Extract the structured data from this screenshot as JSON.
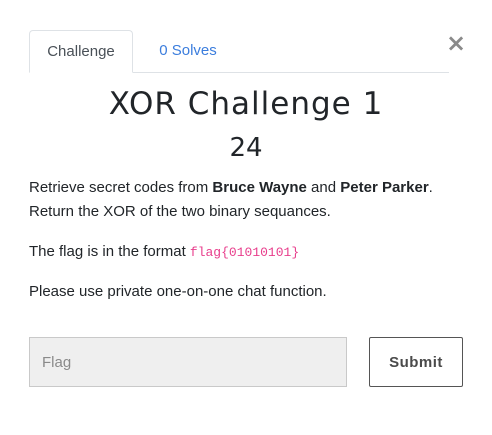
{
  "tabs": [
    {
      "label": "Challenge"
    },
    {
      "label": "0 Solves"
    }
  ],
  "close_glyph": "×",
  "challenge": {
    "title": "XOR Challenge 1",
    "points": "24",
    "desc_prefix": "Retrieve secret codes from ",
    "name1": "Bruce Wayne",
    "desc_and": " and ",
    "name2": "Peter Parker",
    "desc_suffix": ". Return the XOR of the two binary sequances.",
    "flag_prefix": "The flag is in the format ",
    "flag_format": "flag{01010101}",
    "note": "Please use private one-on-one chat function."
  },
  "form": {
    "flag_placeholder": "Flag",
    "flag_value": "",
    "submit_label": "Submit"
  },
  "colors": {
    "tab_active_text": "#495057",
    "tab_link": "#3b7ddd",
    "code": "#e83e8c",
    "input_bg": "#efefef"
  },
  "icons": {
    "close": "close-icon"
  }
}
